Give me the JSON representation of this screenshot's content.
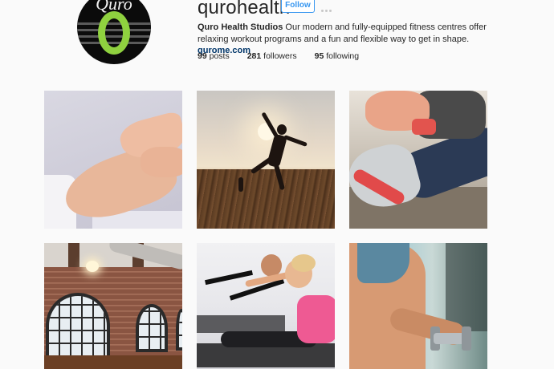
{
  "profile": {
    "username": "qurohealth",
    "follow_label": "Follow",
    "avatar_text": "Quro",
    "bio_name": "Quro Health Studios",
    "bio_text": " Our modern and fully-equipped fitness centres offer relaxing workout programs and a fun and flexible way to get in shape. ",
    "bio_link": "qurome.com",
    "stats": {
      "posts_count": "99",
      "posts_label": "posts",
      "followers_count": "281",
      "followers_label": "followers",
      "following_count": "95",
      "following_label": "following"
    }
  },
  "colors": {
    "accent": "#3897f0",
    "link": "#003569",
    "background": "#fafafa",
    "logo_green": "#8fd13f"
  },
  "posts": [
    {
      "subject": "foot massage"
    },
    {
      "subject": "silhouette on pier at sunset"
    },
    {
      "subject": "lacing running shoe"
    },
    {
      "subject": "studio with arched windows"
    },
    {
      "subject": "pilates reformer class"
    },
    {
      "subject": "dumbbell workout"
    }
  ]
}
